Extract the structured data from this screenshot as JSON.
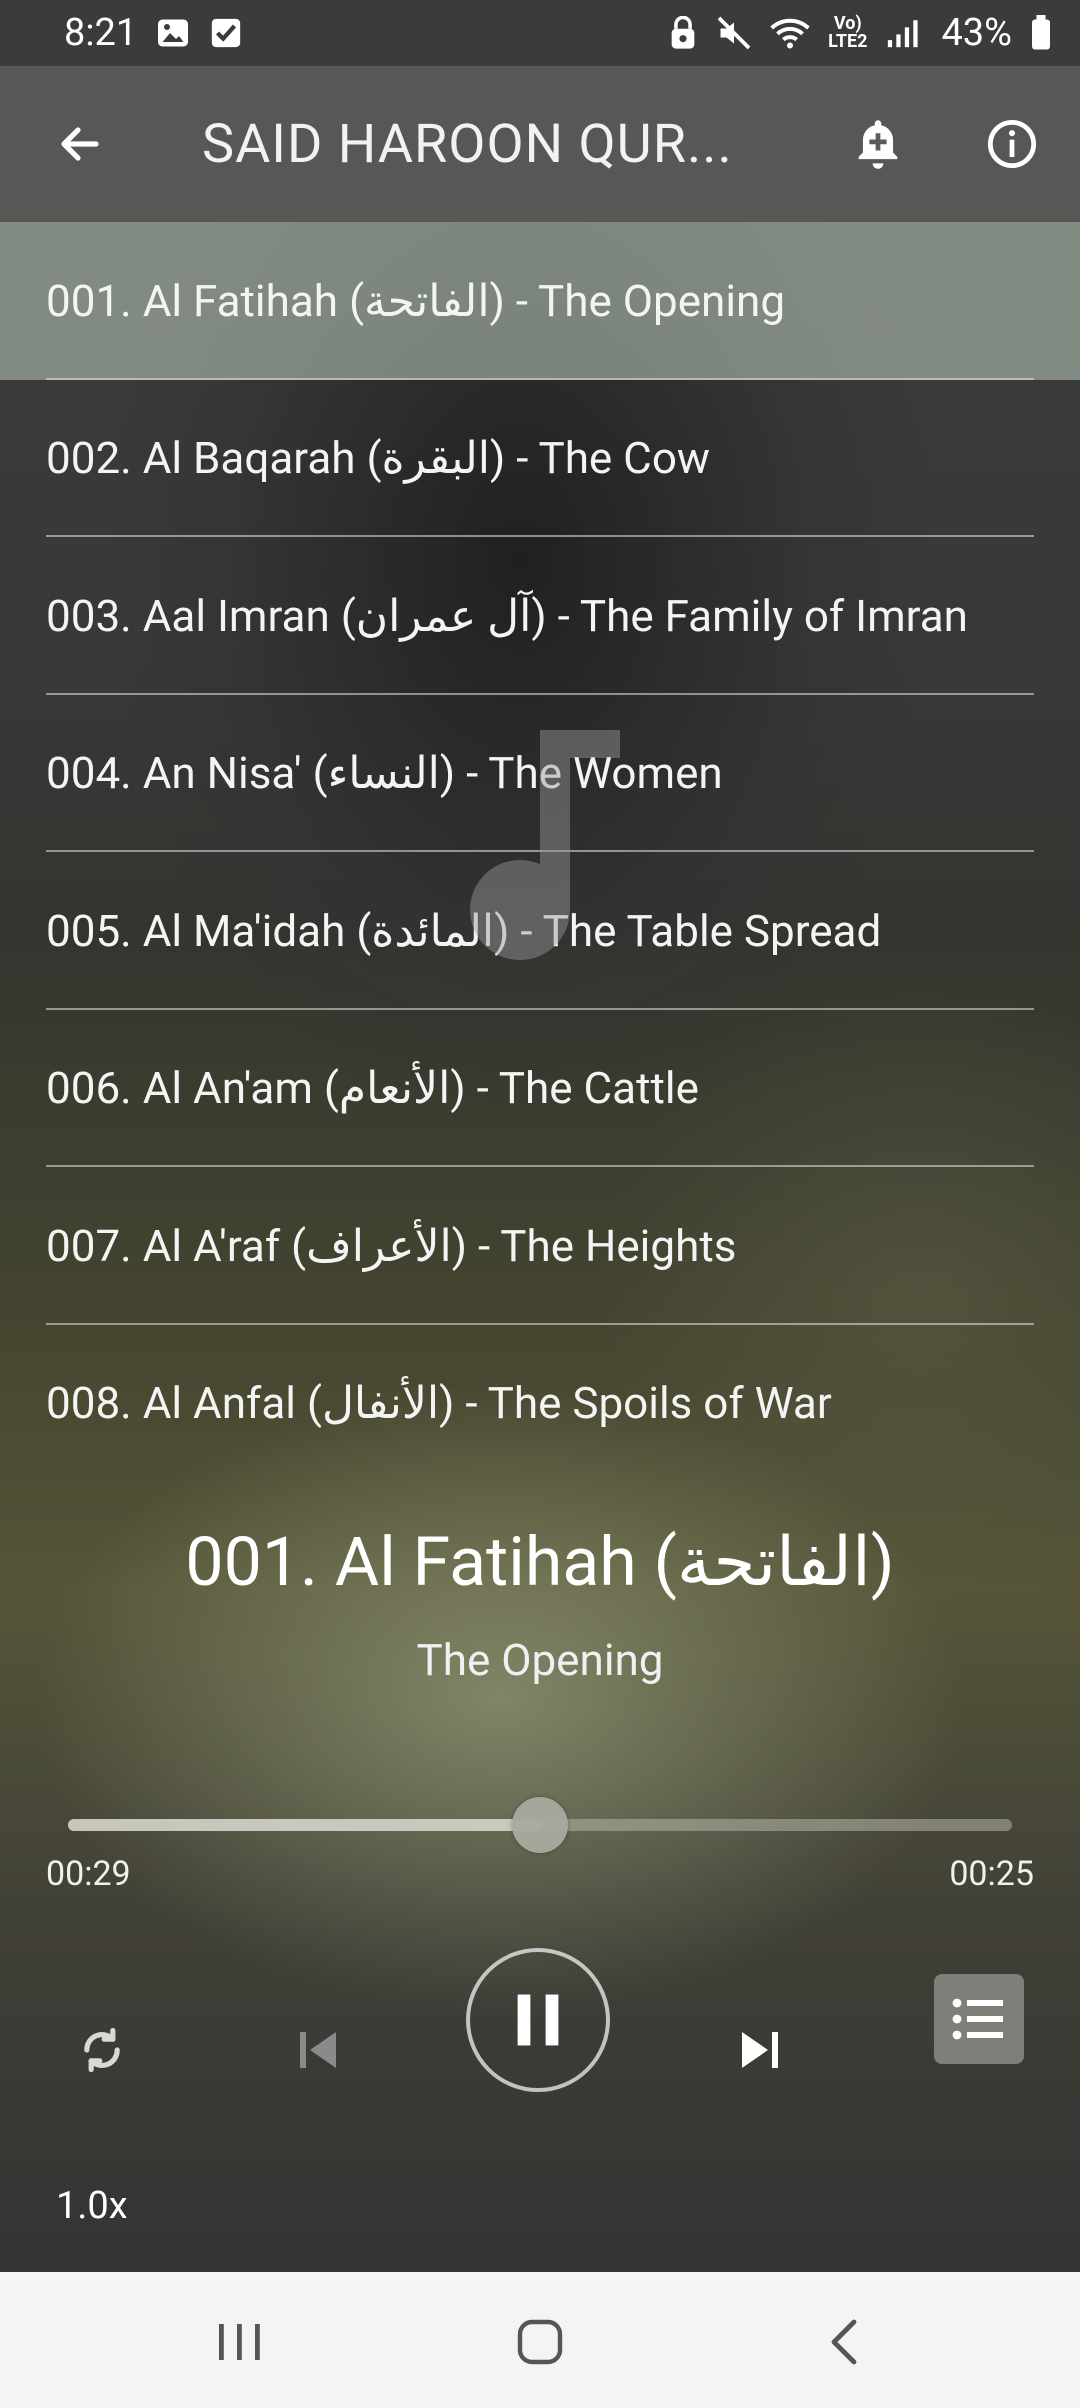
{
  "status_bar": {
    "time": "8:21",
    "battery": "43%",
    "icons": [
      "image-icon",
      "check-box-icon",
      "lock-icon",
      "mute-icon",
      "wifi-icon",
      "volte-icon",
      "signal-icon",
      "battery-icon"
    ]
  },
  "app_bar": {
    "title": "SAID HAROON QUR...",
    "back_icon": "back-arrow-icon",
    "bell_icon": "add-alarm-icon",
    "info_icon": "info-icon"
  },
  "tracks": [
    {
      "label": "001. Al Fatihah (الفاتحة) - The Opening",
      "active": true
    },
    {
      "label": "002. Al Baqarah (البقرة) - The Cow",
      "active": false
    },
    {
      "label": "003. Aal Imran (آل عمران) - The Family of Imran",
      "active": false
    },
    {
      "label": "004. An Nisa' (النساء) - The Women",
      "active": false
    },
    {
      "label": "005. Al Ma'idah (المائدة) - The Table Spread",
      "active": false
    },
    {
      "label": "006. Al An'am (الأنعام) - The Cattle",
      "active": false
    },
    {
      "label": "007. Al A'raf (الأعراف) - The Heights",
      "active": false
    },
    {
      "label": "008. Al Anfal (الأنفال) - The Spoils of War",
      "active": false
    }
  ],
  "player": {
    "title": "001. Al Fatihah (الفاتحة)",
    "subtitle": "The Opening",
    "elapsed": "00:29",
    "remaining": "00:25",
    "progress": 0.5,
    "speed": "1.0x"
  },
  "colors": {
    "accent": "#ffffff",
    "active_row": "#bfcdbf",
    "nav_bar": "#f4f4f4"
  }
}
